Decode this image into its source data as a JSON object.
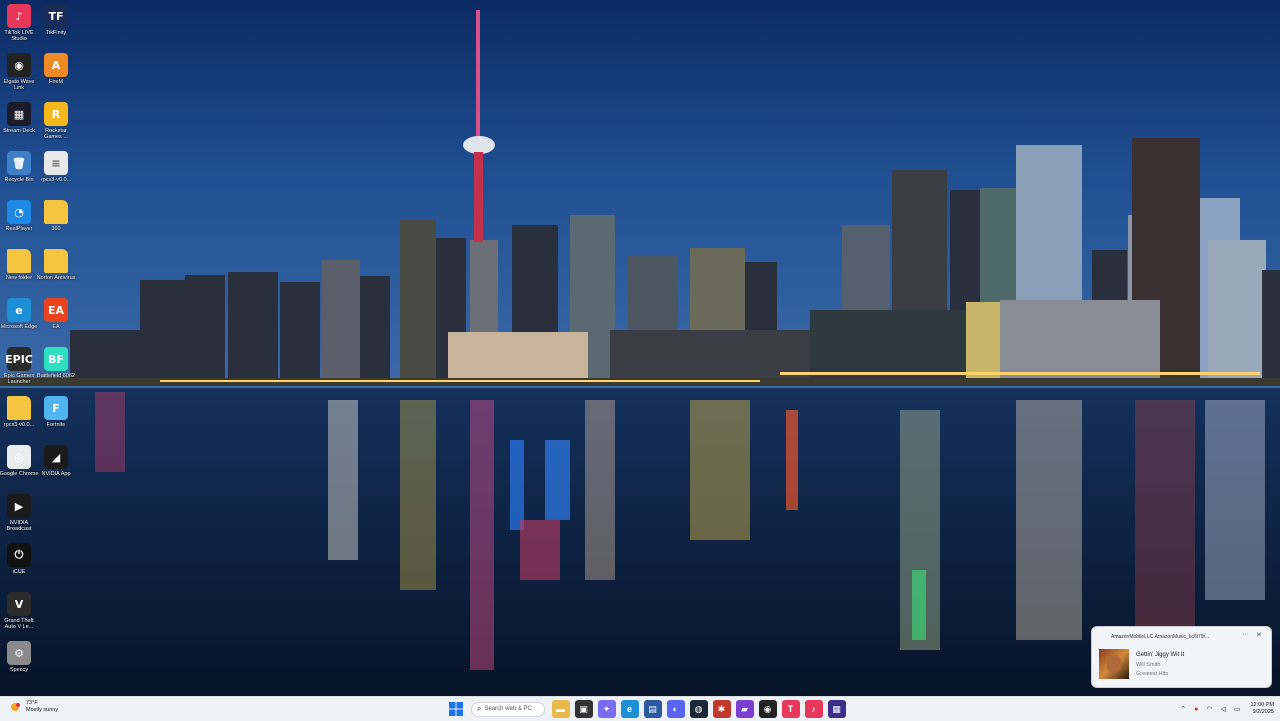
{
  "desktop_icons": [
    {
      "label": "TikTok LIVE Studio",
      "icon": "tiktok-live-icon",
      "color": "#e8375a",
      "glyph": "♪",
      "col": 0,
      "row": 0
    },
    {
      "label": "TikFinity",
      "icon": "tikfinity-icon",
      "color": "#1a2c55",
      "glyph": "TF",
      "col": 1,
      "row": 0
    },
    {
      "label": "Elgato Wave Link",
      "icon": "wave-link-icon",
      "color": "#222222",
      "glyph": "◉",
      "col": 0,
      "row": 1
    },
    {
      "label": "FireM",
      "icon": "firem-icon",
      "color": "#f08a24",
      "glyph": "A",
      "col": 1,
      "row": 1
    },
    {
      "label": "Stream Deck",
      "icon": "stream-deck-icon",
      "color": "#1b1b2a",
      "glyph": "▦",
      "col": 0,
      "row": 2
    },
    {
      "label": "Rockstar Games ...",
      "icon": "rockstar-icon",
      "color": "#f4b81c",
      "glyph": "R",
      "col": 1,
      "row": 2
    },
    {
      "label": "Recycle Bin",
      "icon": "recycle-bin-icon",
      "color": "#3e7fc7",
      "glyph": "🗑",
      "col": 0,
      "row": 3
    },
    {
      "label": "rpcs3-v0.0...",
      "icon": "document-icon",
      "color": "#e8e8e8",
      "glyph": "≡",
      "col": 1,
      "row": 3
    },
    {
      "label": "RealPlayer",
      "icon": "realplayer-icon",
      "color": "#1e88e5",
      "glyph": "◔",
      "col": 0,
      "row": 4
    },
    {
      "label": "360",
      "icon": "folder-icon",
      "color": "#f5c542",
      "glyph": "",
      "col": 1,
      "row": 4
    },
    {
      "label": "New folder",
      "icon": "folder-icon",
      "color": "#f5c542",
      "glyph": "",
      "col": 0,
      "row": 5
    },
    {
      "label": "Norton Antivirus",
      "icon": "folder-icon",
      "color": "#f5c542",
      "glyph": "",
      "col": 1,
      "row": 5
    },
    {
      "label": "Microsoft Edge",
      "icon": "edge-icon",
      "color": "#1c8fd6",
      "glyph": "e",
      "col": 0,
      "row": 6
    },
    {
      "label": "EA",
      "icon": "ea-icon",
      "color": "#e8431c",
      "glyph": "EA",
      "col": 1,
      "row": 6
    },
    {
      "label": "Epic Games Launcher",
      "icon": "epic-games-icon",
      "color": "#2a2a2a",
      "glyph": "EPIC",
      "col": 0,
      "row": 7
    },
    {
      "label": "Battlefield 6062",
      "icon": "battlefield-icon",
      "color": "#2fe0c0",
      "glyph": "BF",
      "col": 1,
      "row": 7
    },
    {
      "label": "rpcs3-v0.0...",
      "icon": "folder-icon",
      "color": "#f5c542",
      "glyph": "",
      "col": 0,
      "row": 8
    },
    {
      "label": "Fortnite",
      "icon": "fortnite-icon",
      "color": "#4fb4f0",
      "glyph": "F",
      "col": 1,
      "row": 8
    },
    {
      "label": "Google Chrome",
      "icon": "chrome-icon",
      "color": "#e9ecef",
      "glyph": "◎",
      "col": 0,
      "row": 9
    },
    {
      "label": "NVIDIA App",
      "icon": "nvidia-icon",
      "color": "#1a1a1a",
      "glyph": "◢",
      "col": 1,
      "row": 9
    },
    {
      "label": "NVIDIA Broadcast",
      "icon": "nvidia-broadcast-icon",
      "color": "#1a1a1a",
      "glyph": "▶",
      "col": 0,
      "row": 10
    },
    {
      "label": "iCUE",
      "icon": "icue-icon",
      "color": "#111111",
      "glyph": "⏻",
      "col": 0,
      "row": 11
    },
    {
      "label": "Grand Theft Auto V Le...",
      "icon": "gta-icon",
      "color": "#2b2b2b",
      "glyph": "V",
      "col": 0,
      "row": 12
    },
    {
      "label": "Speccy",
      "icon": "speccy-icon",
      "color": "#8a8a8a",
      "glyph": "⚙",
      "col": 0,
      "row": 13
    }
  ],
  "taskbar": {
    "weather_temp": "73°F",
    "weather_desc": "Mostly sunny",
    "search_placeholder": "Search web & PC",
    "apps": [
      {
        "icon": "file-explorer-icon",
        "color": "#e9b949",
        "glyph": "▬"
      },
      {
        "icon": "task-view-icon",
        "color": "#333333",
        "glyph": "▣"
      },
      {
        "icon": "copilot-icon",
        "color": "#7a6cf0",
        "glyph": "✦"
      },
      {
        "icon": "edge-icon",
        "color": "#1c8fd6",
        "glyph": "e"
      },
      {
        "icon": "store-icon",
        "color": "#2b5aa0",
        "glyph": "▤"
      },
      {
        "icon": "discord-icon",
        "color": "#5865f2",
        "glyph": "◐"
      },
      {
        "icon": "steam-icon",
        "color": "#1b2838",
        "glyph": "◍"
      },
      {
        "icon": "rockstar-icon",
        "color": "#c0392b",
        "glyph": "✱"
      },
      {
        "icon": "clipchamp-icon",
        "color": "#7b3fd0",
        "glyph": "▰"
      },
      {
        "icon": "obs-icon",
        "color": "#222222",
        "glyph": "◉"
      },
      {
        "icon": "tikfinity-icon",
        "color": "#e8375a",
        "glyph": "T"
      },
      {
        "icon": "tiktok-live-icon",
        "color": "#e8375a",
        "glyph": "♪"
      },
      {
        "icon": "media-app-icon",
        "color": "#3a2d8c",
        "glyph": "▦"
      }
    ],
    "clock_time": "12:00 PM",
    "clock_date": "9/2/2025"
  },
  "notification": {
    "app_name": "AmazonMobileLLC.AmazonMusic_kc6t79r...",
    "song": "Gettin' Jiggy Wit It",
    "artist": "Will Smith",
    "album": "Greatest Hits"
  }
}
